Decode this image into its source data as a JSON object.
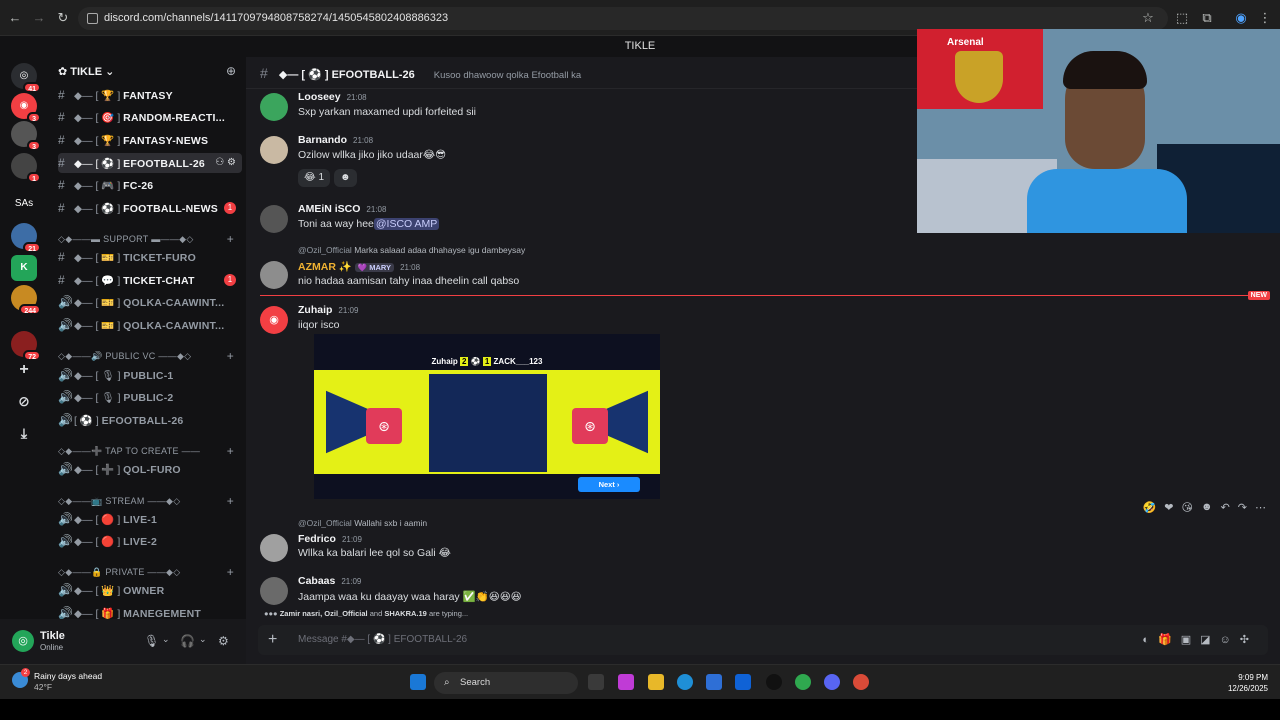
{
  "browser": {
    "url": "discord.com/channels/1411709794808758274/1450545802408886323",
    "back_icon": "arrow-left-icon",
    "forward_icon": "arrow-right-icon",
    "reload_icon": "reload-icon"
  },
  "window_title": "TIKLE",
  "server_rail": {
    "items": [
      {
        "label": "",
        "badge": "41"
      },
      {
        "label": "",
        "badge": "3"
      },
      {
        "label": "",
        "badge": "3"
      },
      {
        "label": "",
        "badge": "1"
      },
      {
        "label": "SAs",
        "badge": ""
      },
      {
        "label": "",
        "badge": "21"
      },
      {
        "label": "K",
        "badge": ""
      },
      {
        "label": "",
        "badge": "244"
      },
      {
        "label": "",
        "badge": "72"
      }
    ]
  },
  "server": {
    "name": "TIKLE",
    "channels": [
      {
        "label": "FANTASY",
        "prefix": "◆— [ 🏆 ]",
        "type": "text",
        "unread": ""
      },
      {
        "label": "RANDOM-REACTI...",
        "prefix": "◆— [ 🎯 ]",
        "type": "text",
        "unread": ""
      },
      {
        "label": "FANTASY-NEWS",
        "prefix": "◆— [ 🏆 ]",
        "type": "text",
        "unread": ""
      },
      {
        "label": "EFOOTBALL-26",
        "prefix": "◆— [ ⚽ ]",
        "type": "text",
        "unread": "",
        "active": true
      },
      {
        "label": "FC-26",
        "prefix": "◆— [ 🎮 ]",
        "type": "text",
        "unread": ""
      },
      {
        "label": "FOOTBALL-NEWS",
        "prefix": "◆— [ ⚽ ]",
        "type": "text",
        "unread": "1"
      }
    ],
    "cat_support": "◇◆——▬ SUPPORT ▬——◆◇",
    "support_channels": [
      {
        "label": "TICKET-FURO",
        "prefix": "◆— [ 🎫 ]",
        "unread": ""
      },
      {
        "label": "TICKET-CHAT",
        "prefix": "◆— [ 💬 ]",
        "unread": "1"
      },
      {
        "label": "QOLKA-CAAWINT...",
        "prefix": "◆— [ 🎫 ]",
        "unread": ""
      },
      {
        "label": "QOLKA-CAAWINT...",
        "prefix": "◆— [ 🎫 ]",
        "unread": ""
      }
    ],
    "cat_public": "◇◆——🔊 PUBLIC VC ——◆◇",
    "public_channels": [
      {
        "label": "PUBLIC-1",
        "prefix": "◆— [ 🎙 ]"
      },
      {
        "label": "PUBLIC-2",
        "prefix": "◆— [ 🎙 ]"
      },
      {
        "label": "EFOOTBALL-26",
        "prefix": "[ ⚽ ]"
      }
    ],
    "cat_tap": "◇◆——➕ TAP TO CREATE ——",
    "tap_channels": [
      {
        "label": "QOL-FURO",
        "prefix": "◆— [ ➕ ]"
      }
    ],
    "cat_stream": "◇◆——📺 STREAM ——◆◇",
    "stream_channels": [
      {
        "label": "LIVE-1",
        "prefix": "◆— [ 🔴 ]"
      },
      {
        "label": "LIVE-2",
        "prefix": "◆— [ 🔴 ]"
      }
    ],
    "cat_private": "◇◆——🔒 PRIVATE ——◆◇",
    "private_channels": [
      {
        "label": "OWNER",
        "prefix": "◆— [ 👑 ]"
      },
      {
        "label": "MANEGEMENT",
        "prefix": "◆— [ 🎁 ]"
      }
    ]
  },
  "user": {
    "name": "Tikle",
    "status": "Online"
  },
  "channel_header": {
    "prefix": "◆— [ ⚽ ]",
    "name": "EFOOTBALL-26",
    "topic": "Kusoo dhawoow qolka Efootball ka"
  },
  "messages": [
    {
      "author": "Looseey",
      "time": "21:08",
      "text": "Sxp yarkan  maxamed updi forfeited sii"
    },
    {
      "author": "Barnando",
      "time": "21:08",
      "text": "Ozilow wllka jiko jiko udaar😂😎",
      "reactions": [
        "😂 1",
        "☻"
      ]
    },
    {
      "author": "AMEiN iSCO",
      "time": "21:08",
      "text": "Toni aa way hee",
      "mention": "@ISCO AMP"
    },
    {
      "author": "AZMAR ✨",
      "tag": "💜 MARY",
      "time": "21:08",
      "reply_user": "@Ozil_Official",
      "reply_text": "Marka salaad adaa dhahayse igu dambeysay",
      "text": "nio hadaa aamisan tahy inaa dheelin call qabso"
    },
    {
      "author": "Zuhaip",
      "time": "21:09",
      "text": "iiqor isco"
    },
    {
      "author": "Fedrico",
      "time": "21:09",
      "reply_user": "@Ozil_Official",
      "reply_text": "Wallahi sxb i aamin",
      "text": "Wllka ka balari lee qol so Gali 😂"
    },
    {
      "author": "Cabaas",
      "time": "21:09",
      "text": "Jaampa waa ku daayay waa haray ✅👏😆😆😆"
    }
  ],
  "new_marker": "NEW",
  "attachment": {
    "home": "Zuhaip",
    "home_score": "2",
    "away_score": "1",
    "away": "ZACK___123",
    "next_label": "Next ›"
  },
  "typing": {
    "users": "Zamir nasri, Ozil_Official",
    "and": "and",
    "last": "SHAKRA.19",
    "suffix": "are typing..."
  },
  "composer": {
    "placeholder": "Message #◆— [ ⚽ ] EFOOTBALL-26"
  },
  "webcam": {
    "flag_text": "Arsenal"
  },
  "taskbar": {
    "weather_title": "Rainy days ahead",
    "weather_temp": "42°F",
    "weather_badge": "2",
    "search_label": "Search",
    "time": "9:09 PM",
    "date": "12/26/2025"
  },
  "colors": {
    "accent": "#5865f2",
    "danger": "#f23f43",
    "online": "#23a559"
  }
}
